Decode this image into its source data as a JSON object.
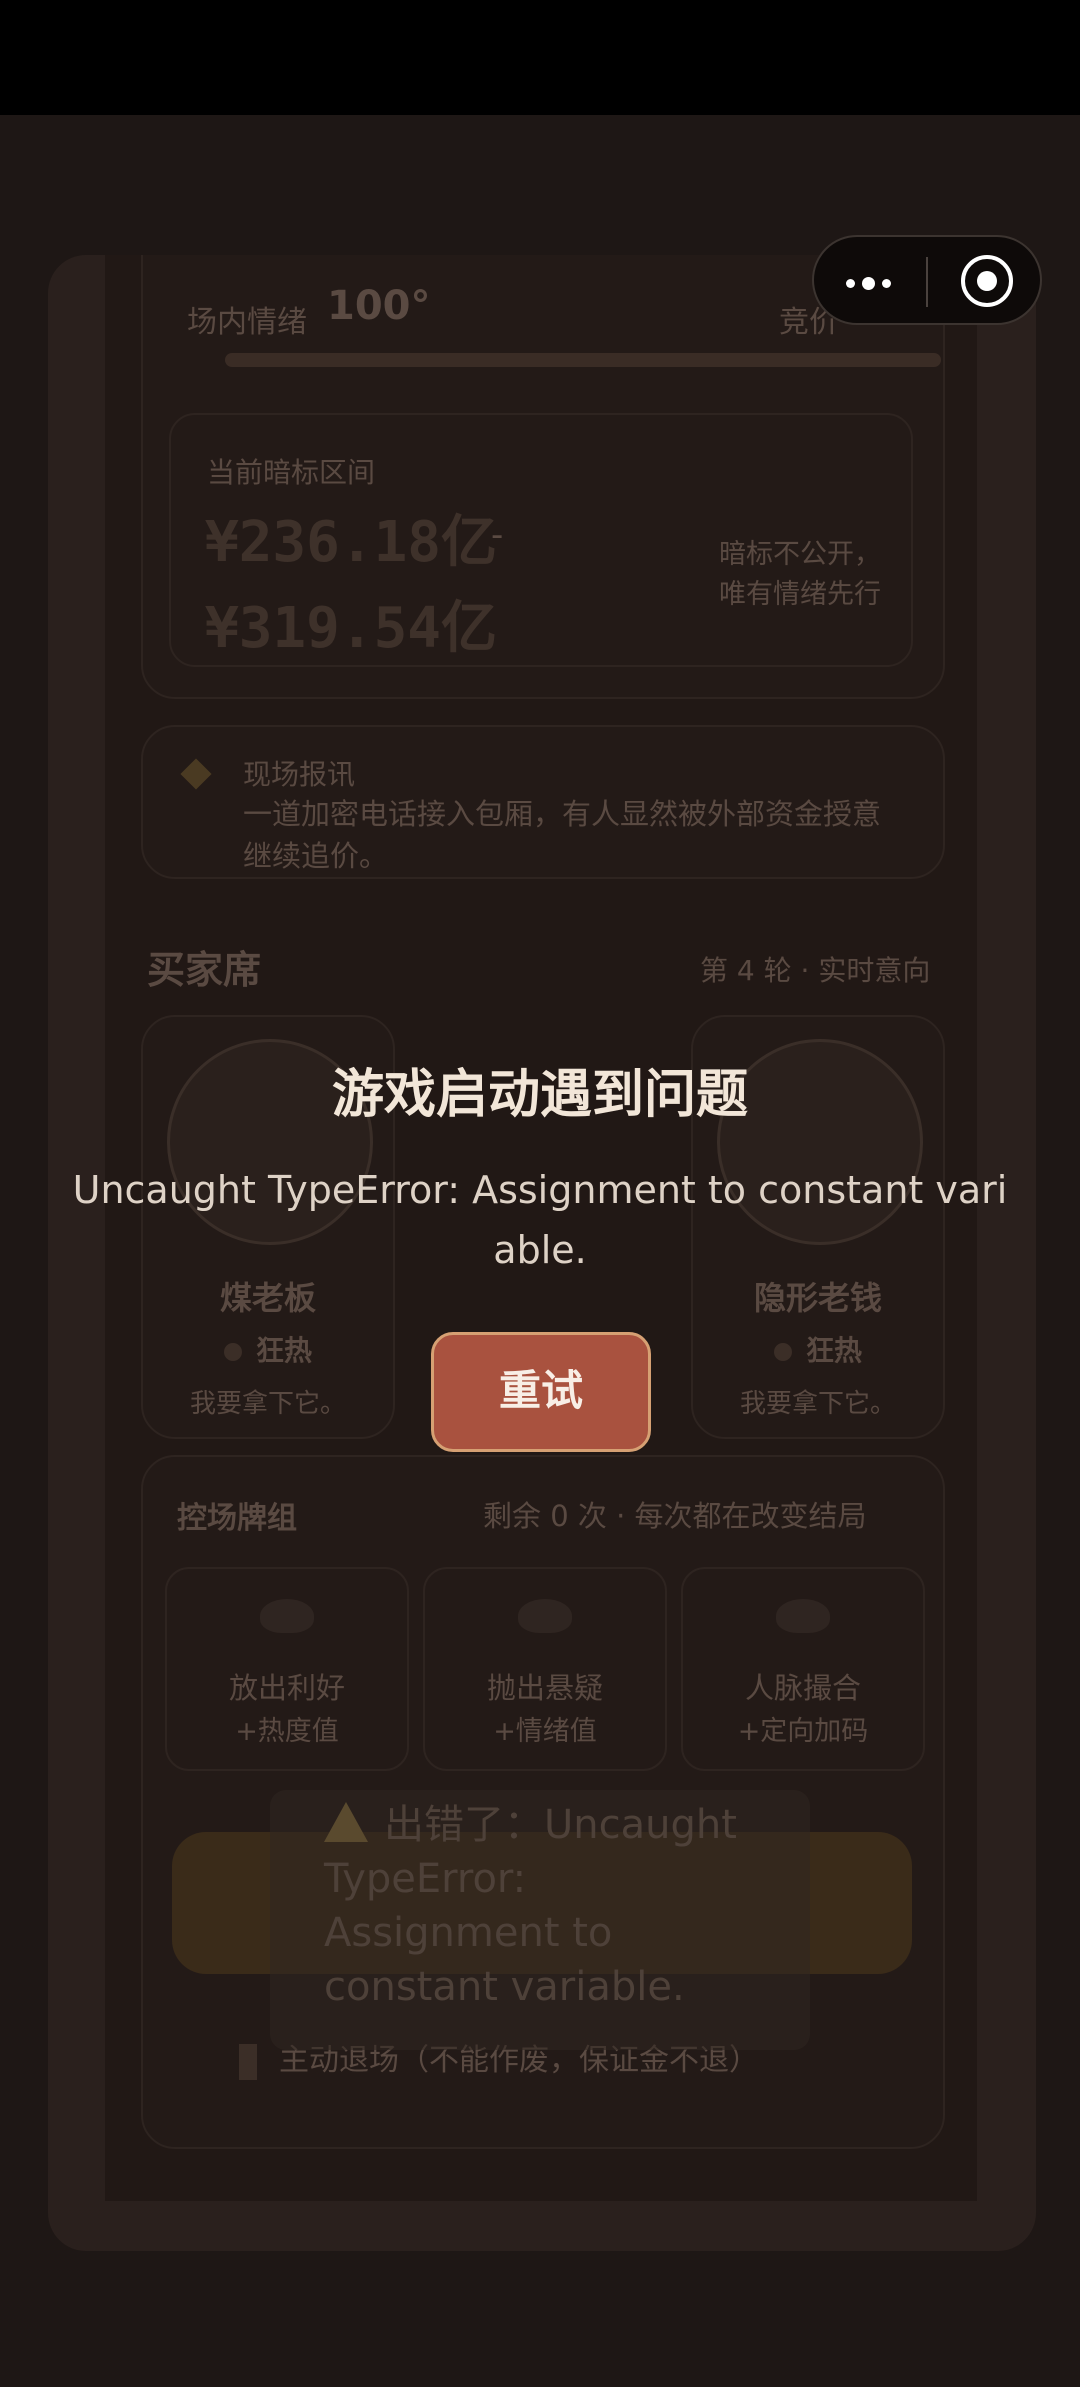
{
  "overlay": {
    "title": "游戏启动遇到问题",
    "message": "Uncaught TypeError: Assignment to constant variable.",
    "retry_label": "重试"
  },
  "toast": {
    "text": "出错了：Uncaught TypeError: Assignment to constant variable."
  },
  "capsule": {
    "more_icon": "more-dots-icon",
    "close_icon": "target-icon"
  },
  "game": {
    "mood_label": "场内情绪",
    "mood_value": "100°",
    "bid_label": "竞价",
    "range_label": "当前暗标区间",
    "range_low": "¥236.18亿",
    "range_sep": "-",
    "range_high": "¥319.54亿",
    "range_note": "暗标不公开，唯有情绪先行",
    "scene_title": "现场报讯",
    "scene_text": "一道加密电话接入包厢，有人显然被外部资金授意继续追价。",
    "buyers_title": "买家席",
    "buyers_meta": "第 4 轮 · 实时意向",
    "buyers": [
      {
        "name": "煤老板",
        "state": "狂热",
        "quote": "我要拿下它。"
      },
      {
        "name": "隐形老钱",
        "state": "狂热",
        "quote": "我要拿下它。"
      }
    ],
    "deck_title": "控场牌组",
    "deck_meta": "剩余 0 次 · 每次都在改变结局",
    "cards": [
      {
        "name": "放出利好",
        "desc": "+热度值"
      },
      {
        "name": "抛出悬疑",
        "desc": "+情绪值"
      },
      {
        "name": "人脉撮合",
        "desc": "+定向加码"
      }
    ],
    "footer_note": "主动退场（不能作废，保证金不退）"
  },
  "colors": {
    "accent": "#a9523f",
    "background": "#1e1715",
    "title": "#f2e6d8"
  }
}
